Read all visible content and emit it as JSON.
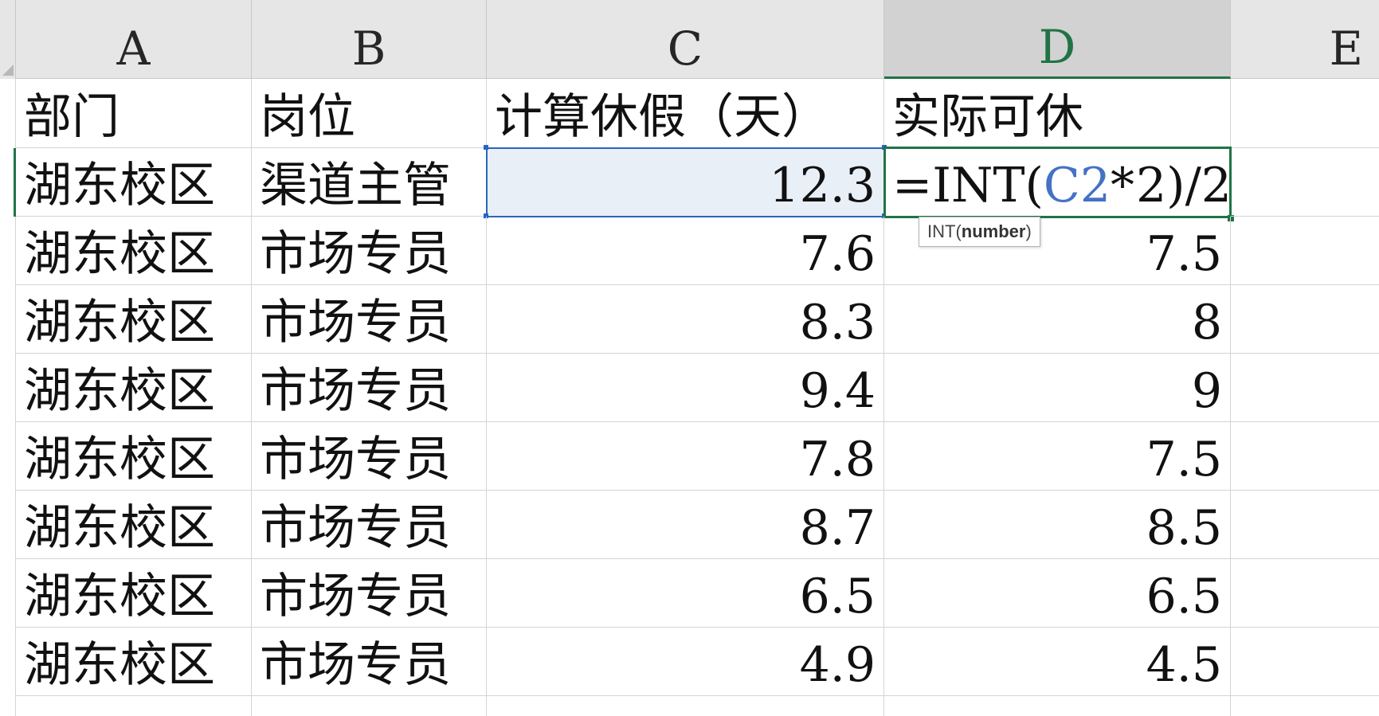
{
  "columns": [
    "A",
    "B",
    "C",
    "D",
    "E"
  ],
  "active_column": "D",
  "header_row": {
    "a": "部门",
    "b": "岗位",
    "c": "计算休假（天）",
    "d": "实际可休"
  },
  "formula_cell": {
    "prefix": "=INT(",
    "reference": "C2",
    "operator": "*",
    "after_caret": "2)/2"
  },
  "tooltip": {
    "function_name": "INT",
    "open_paren": "(",
    "argument": "number",
    "close_paren": ")"
  },
  "rows": [
    {
      "a": "湖东校区",
      "b": "渠道主管",
      "c": "12.3",
      "d": ""
    },
    {
      "a": "湖东校区",
      "b": "市场专员",
      "c": "7.6",
      "d": "7.5"
    },
    {
      "a": "湖东校区",
      "b": "市场专员",
      "c": "8.3",
      "d": "8"
    },
    {
      "a": "湖东校区",
      "b": "市场专员",
      "c": "9.4",
      "d": "9"
    },
    {
      "a": "湖东校区",
      "b": "市场专员",
      "c": "7.8",
      "d": "7.5"
    },
    {
      "a": "湖东校区",
      "b": "市场专员",
      "c": "8.7",
      "d": "8.5"
    },
    {
      "a": "湖东校区",
      "b": "市场专员",
      "c": "6.5",
      "d": "6.5"
    },
    {
      "a": "湖东校区",
      "b": "市场专员",
      "c": "4.9",
      "d": "4.5"
    }
  ]
}
